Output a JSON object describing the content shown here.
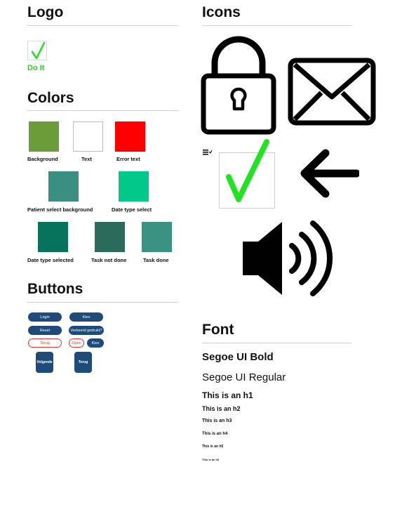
{
  "sections": {
    "logo": "Logo",
    "colors": "Colors",
    "buttons": "Buttons",
    "icons": "Icons",
    "font": "Font"
  },
  "logo": {
    "text": "Do It",
    "icon": "checkmark-icon"
  },
  "colors": [
    {
      "label": "Background",
      "hex": "#6a9c3a"
    },
    {
      "label": "Text",
      "hex": "#ffffff"
    },
    {
      "label": "Error text",
      "hex": "#ff0000"
    },
    {
      "label": "Patient select background",
      "hex": "#3a8f80"
    },
    {
      "label": "Date type select",
      "hex": "#00c98a"
    },
    {
      "label": "Date type selected",
      "hex": "#06735a"
    },
    {
      "label": "Task not done",
      "hex": "#2b6b5e"
    },
    {
      "label": "Task done",
      "hex": "#3a9381"
    }
  ],
  "buttons": {
    "login": "Login",
    "kies": "Kies",
    "reset": "Reset",
    "verkeerd": "Verkeerd gedrukt?",
    "terug_outline": "Terug",
    "open": "Open",
    "kies_small": "Kies",
    "volgende": "Volgende",
    "terug": "Terug",
    "primary_color": "#1f4b7a",
    "error_color": "#e33"
  },
  "icons": [
    "padlock-icon",
    "envelope-icon",
    "menu-icon",
    "checkmark-icon",
    "arrow-left-icon",
    "speaker-icon"
  ],
  "font": {
    "bold": "Segoe UI Bold",
    "regular": "Segoe UI Regular",
    "h1": "This is an h1",
    "h2": "This is an h2",
    "h3": "This is an h3",
    "h4": "This is an h4",
    "h5": "This is an h5",
    "h6": "This is an h6"
  }
}
